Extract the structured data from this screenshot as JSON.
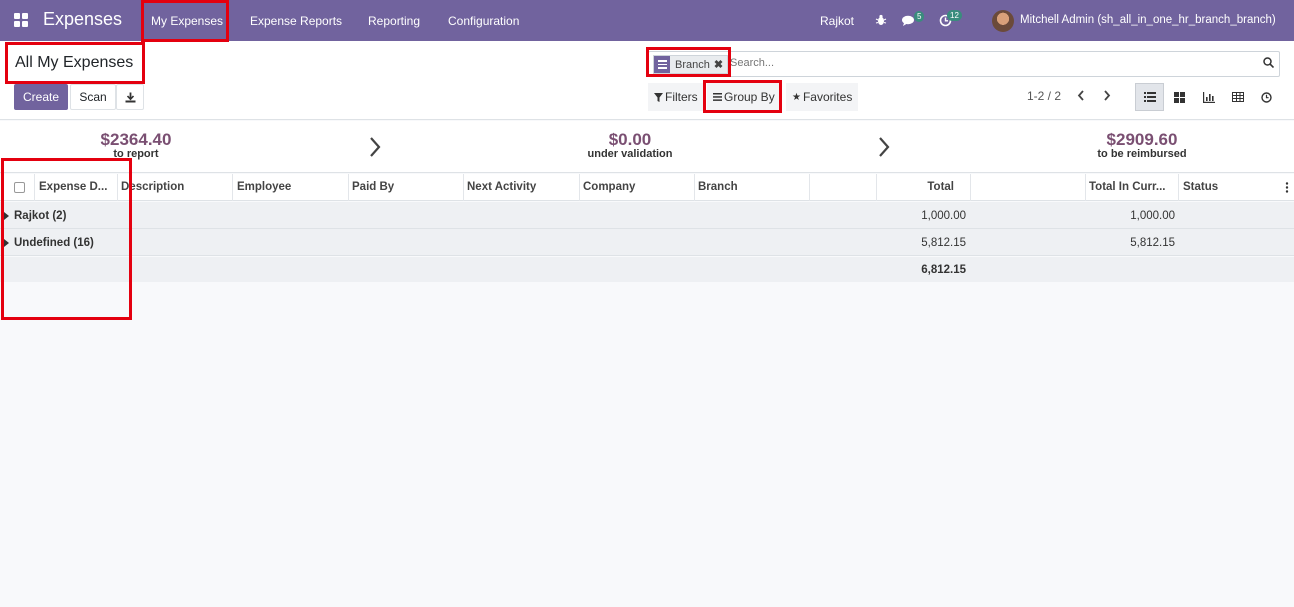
{
  "navbar": {
    "app_name": "Expenses",
    "menu": [
      "My Expenses",
      "Expense Reports",
      "Reporting",
      "Configuration"
    ],
    "branch": "Rajkot",
    "messages_count": "5",
    "activities_count": "12",
    "user": "Mitchell Admin (sh_all_in_one_hr_branch_branch)",
    "color": "#71639e"
  },
  "control": {
    "title": "All My Expenses",
    "create_label": "Create",
    "scan_label": "Scan",
    "facet_label": "Branch",
    "facet_remove": "✖",
    "search_placeholder": "Search...",
    "filters_label": "Filters",
    "groupby_label": "Group By",
    "favorites_label": "Favorites",
    "pager": "1-2 / 2"
  },
  "stats": [
    {
      "value": "$2364.40",
      "label": "to report"
    },
    {
      "value": "$0.00",
      "label": "under validation"
    },
    {
      "value": "$2909.60",
      "label": "to be reimbursed"
    }
  ],
  "table": {
    "columns": [
      "Expense D...",
      "Description",
      "Employee",
      "Paid By",
      "Next Activity",
      "Company",
      "Branch",
      "Total",
      "Total In Curr...",
      "Status"
    ],
    "groups": [
      {
        "label": "Rajkot (2)",
        "total": "1,000.00",
        "total_currency": "1,000.00"
      },
      {
        "label": "Undefined (16)",
        "total": "5,812.15",
        "total_currency": "5,812.15"
      }
    ],
    "grand_total": "6,812.15"
  }
}
